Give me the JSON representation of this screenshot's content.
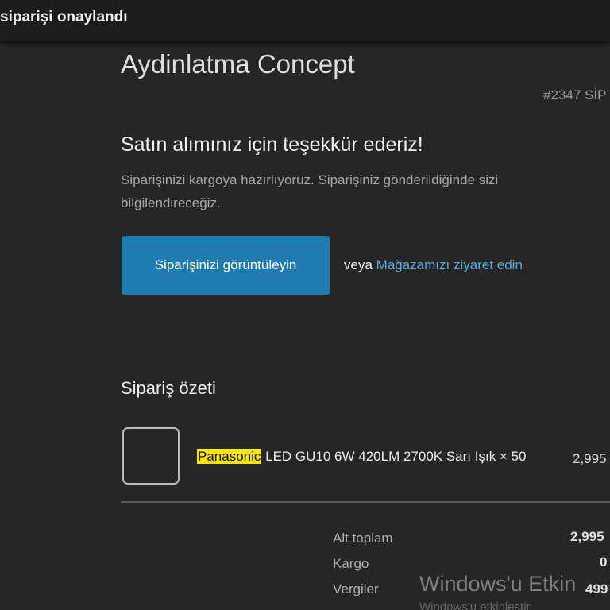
{
  "window": {
    "title": "siparişi onaylandı"
  },
  "shop": {
    "name": "Aydinlatma Concept",
    "order_number": "#2347 SİP"
  },
  "message": {
    "heading": "Satın alımınız için teşekkür ederiz!",
    "line1": "Siparişinizi kargoya hazırlıyoruz. Siparişiniz gönderildiğinde sizi",
    "line2": "bilgilendireceğiz."
  },
  "actions": {
    "view_order_label": "Siparişinizi görüntüleyin",
    "or_label": "veya",
    "visit_store_label": "Mağazamızı ziyaret edin"
  },
  "summary": {
    "title": "Sipariş özeti",
    "items": [
      {
        "brand": "Panasonic",
        "name": " LED GU10 6W 420LM 2700K Sarı Işık × 50",
        "price": "2,995"
      }
    ],
    "totals": [
      {
        "label": "Alt toplam",
        "value": "2,995"
      },
      {
        "label": "Kargo",
        "value": "0"
      },
      {
        "label": "Vergiler",
        "value": "499"
      }
    ]
  },
  "overlay": {
    "watermark": "Windows'u Etkin",
    "watermark_sub": "Windows'u etkinleştir"
  },
  "colors": {
    "accent": "#1f7bb0",
    "link": "#5aa9dc",
    "highlight": "#ffe600",
    "background": "#262626"
  }
}
